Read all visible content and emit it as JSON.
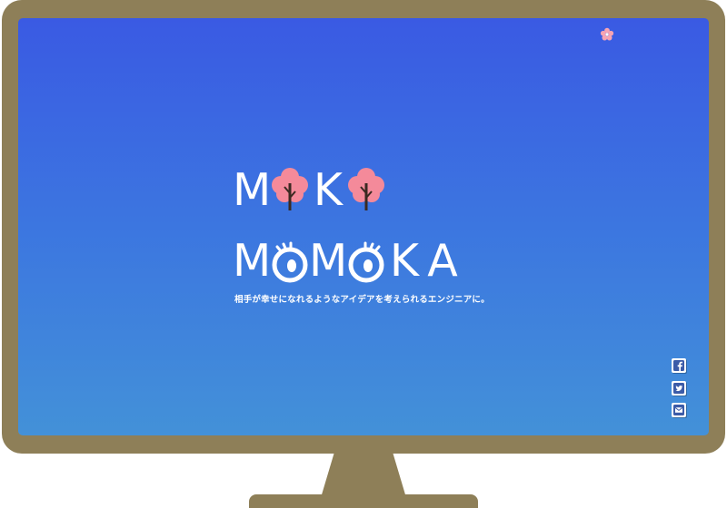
{
  "brand": {
    "line1_letters": [
      "M",
      "K"
    ],
    "line2_letters": [
      "M",
      "M",
      "K",
      "A"
    ],
    "colors": {
      "frame": "#8e7f58",
      "screen_top": "#3a5ae3",
      "screen_bottom": "#4391d8",
      "blossom": "#f48a9a",
      "trunk": "#3b2a22",
      "text": "#ffffff"
    }
  },
  "tagline": "相手が幸せになれるようなアイデアを考えられるエンジニアに。",
  "icons": {
    "corner": "sakura-petal-icon",
    "tree": "cherry-tree-icon",
    "eye": "eye-o-icon",
    "social": [
      "facebook-icon",
      "twitter-icon",
      "mail-icon"
    ]
  }
}
